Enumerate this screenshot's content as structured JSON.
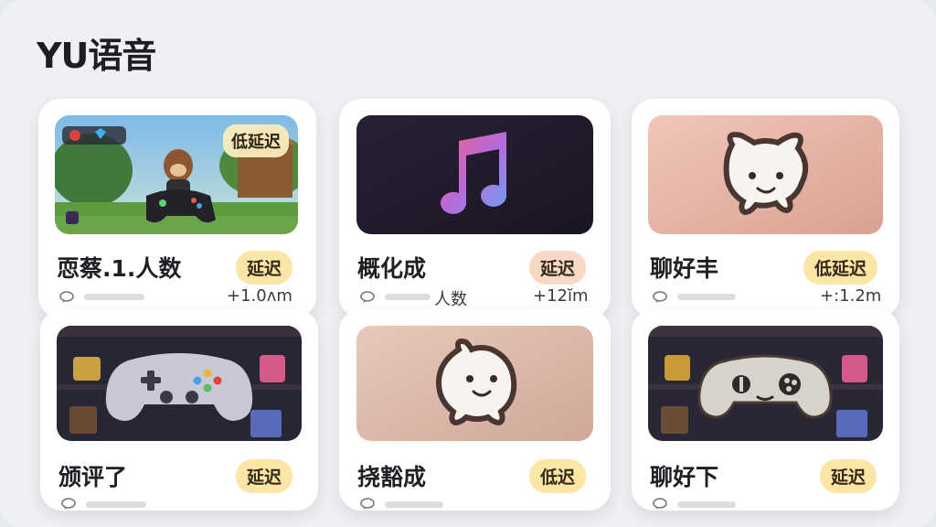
{
  "app": {
    "title": "YU语音"
  },
  "cards": [
    {
      "name": "恧蔡.1.人数",
      "tag": "延迟",
      "overlay_badge": "低延迟",
      "stat": "+1.0ʌm",
      "thumb": "game-world-controller-image"
    },
    {
      "name": "概化成",
      "tag": "延迟",
      "stat_label": "人数",
      "stat": "+12ĭm",
      "thumb": "music-note-image"
    },
    {
      "name": "聊好丰",
      "tag": "低延迟",
      "stat": "+:1.2m",
      "thumb": "chat-bubble-face-image"
    },
    {
      "name": "颁评了",
      "tag": "延迟",
      "thumb": "gamepad-image"
    },
    {
      "name": "挠豁成",
      "tag": "低迟",
      "thumb": "chat-bubble-face-image"
    },
    {
      "name": "聊好下",
      "tag": "延迟",
      "thumb": "gamepad-face-image"
    }
  ],
  "colors": {
    "tag_yellow": "#fbe6a6",
    "tag_peach": "#f9d8c6",
    "background": "#eef0f3"
  },
  "icons": {
    "meta": "chat-bubble-icon"
  }
}
